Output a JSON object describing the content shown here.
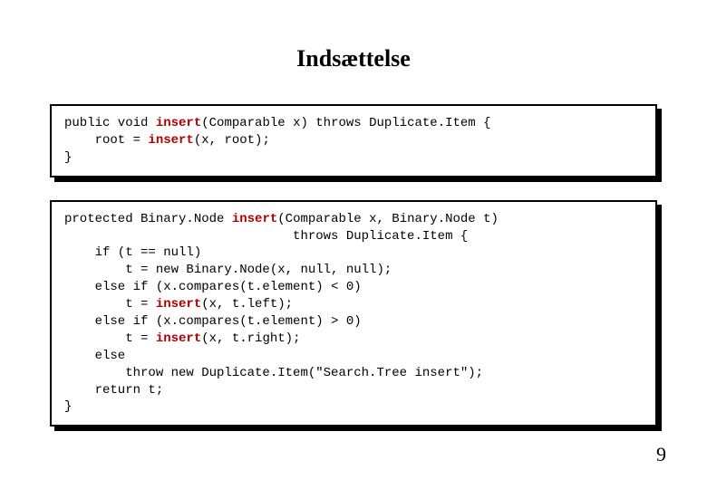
{
  "title": "Indsættelse",
  "page_number": "9",
  "box1": {
    "l1a": "public void ",
    "l1b": "insert",
    "l1c": "(Comparable x) throws Duplicate.Item {",
    "l2a": "    root = ",
    "l2b": "insert",
    "l2c": "(x, root);",
    "l3": "}"
  },
  "box2": {
    "l1a": "protected Binary.Node ",
    "l1b": "insert",
    "l1c": "(Comparable x, Binary.Node t)",
    "l2": "                              throws Duplicate.Item {",
    "l3": "    if (t == null)",
    "l4": "        t = new Binary.Node(x, null, null);",
    "l5": "    else if (x.compares(t.element) < 0)",
    "l6a": "        t = ",
    "l6b": "insert",
    "l6c": "(x, t.left);",
    "l7": "    else if (x.compares(t.element) > 0)",
    "l8a": "        t = ",
    "l8b": "insert",
    "l8c": "(x, t.right);",
    "l9": "    else",
    "l10": "        throw new Duplicate.Item(\"Search.Tree insert\");",
    "l11": "    return t;",
    "l12": "}"
  }
}
